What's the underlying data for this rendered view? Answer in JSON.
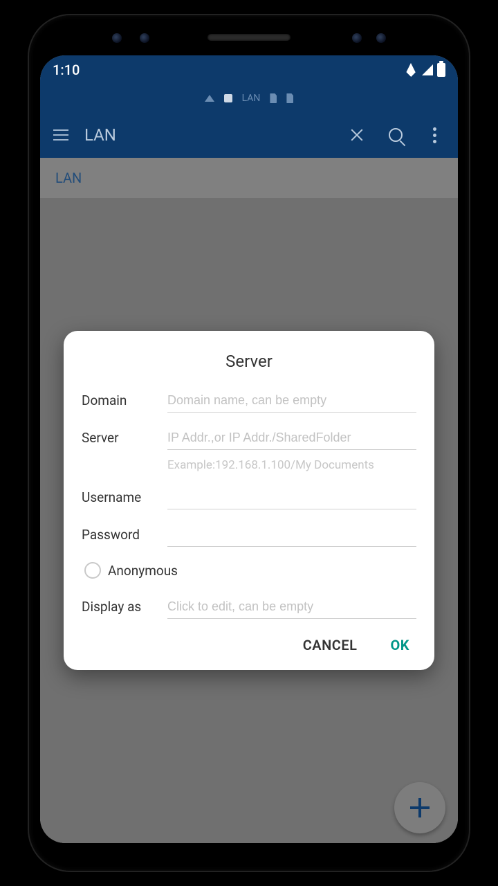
{
  "status": {
    "time": "1:10"
  },
  "crumbs": {
    "label": "LAN"
  },
  "appbar": {
    "title": "LAN"
  },
  "content": {
    "lan_label": "LAN"
  },
  "dialog": {
    "title": "Server",
    "domain_label": "Domain",
    "domain_placeholder": "Domain name, can be empty",
    "server_label": "Server",
    "server_placeholder": "IP Addr.,or IP Addr./SharedFolder",
    "server_hint": "Example:192.168.1.100/My Documents",
    "username_label": "Username",
    "password_label": "Password",
    "anonymous_label": "Anonymous",
    "display_label": "Display as",
    "display_placeholder": "Click to edit, can be empty",
    "cancel": "CANCEL",
    "ok": "OK"
  }
}
